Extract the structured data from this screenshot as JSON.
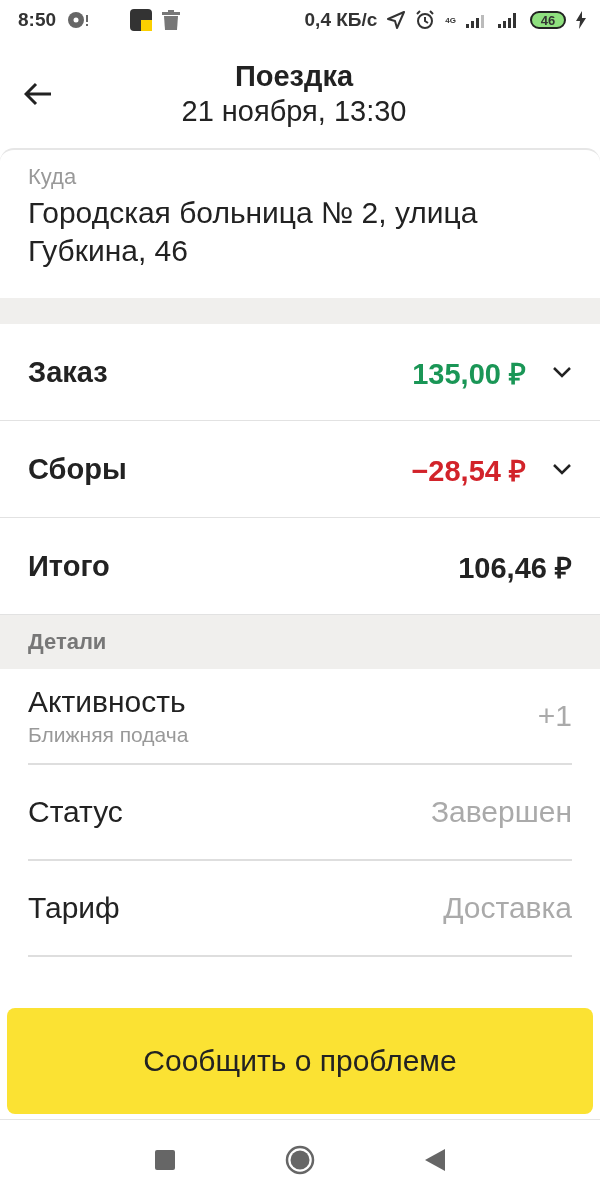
{
  "status_bar": {
    "time": "8:50",
    "speed": "0,4 КБ/с",
    "network": "4G",
    "battery": "46",
    "charging": true
  },
  "header": {
    "title": "Поездка",
    "subtitle": "21 ноября, 13:30"
  },
  "destination": {
    "label": "Куда",
    "value": "Городская больница № 2, улица Губкина, 46"
  },
  "summary": [
    {
      "label": "Заказ",
      "amount": "135,00 ₽",
      "color": "#1a9656",
      "expandable": true
    },
    {
      "label": "Сборы",
      "amount": "−28,54 ₽",
      "color": "#d2232a",
      "expandable": true
    },
    {
      "label": "Итого",
      "amount": "106,46 ₽",
      "color": "#222222",
      "expandable": false
    }
  ],
  "details": {
    "heading": "Детали",
    "rows": [
      {
        "label": "Активность",
        "sublabel": "Ближняя подача",
        "value": "+1"
      },
      {
        "label": "Статус",
        "value": "Завершен"
      },
      {
        "label": "Тариф",
        "value": "Доставка"
      }
    ]
  },
  "action_button": "Сообщить о проблеме"
}
